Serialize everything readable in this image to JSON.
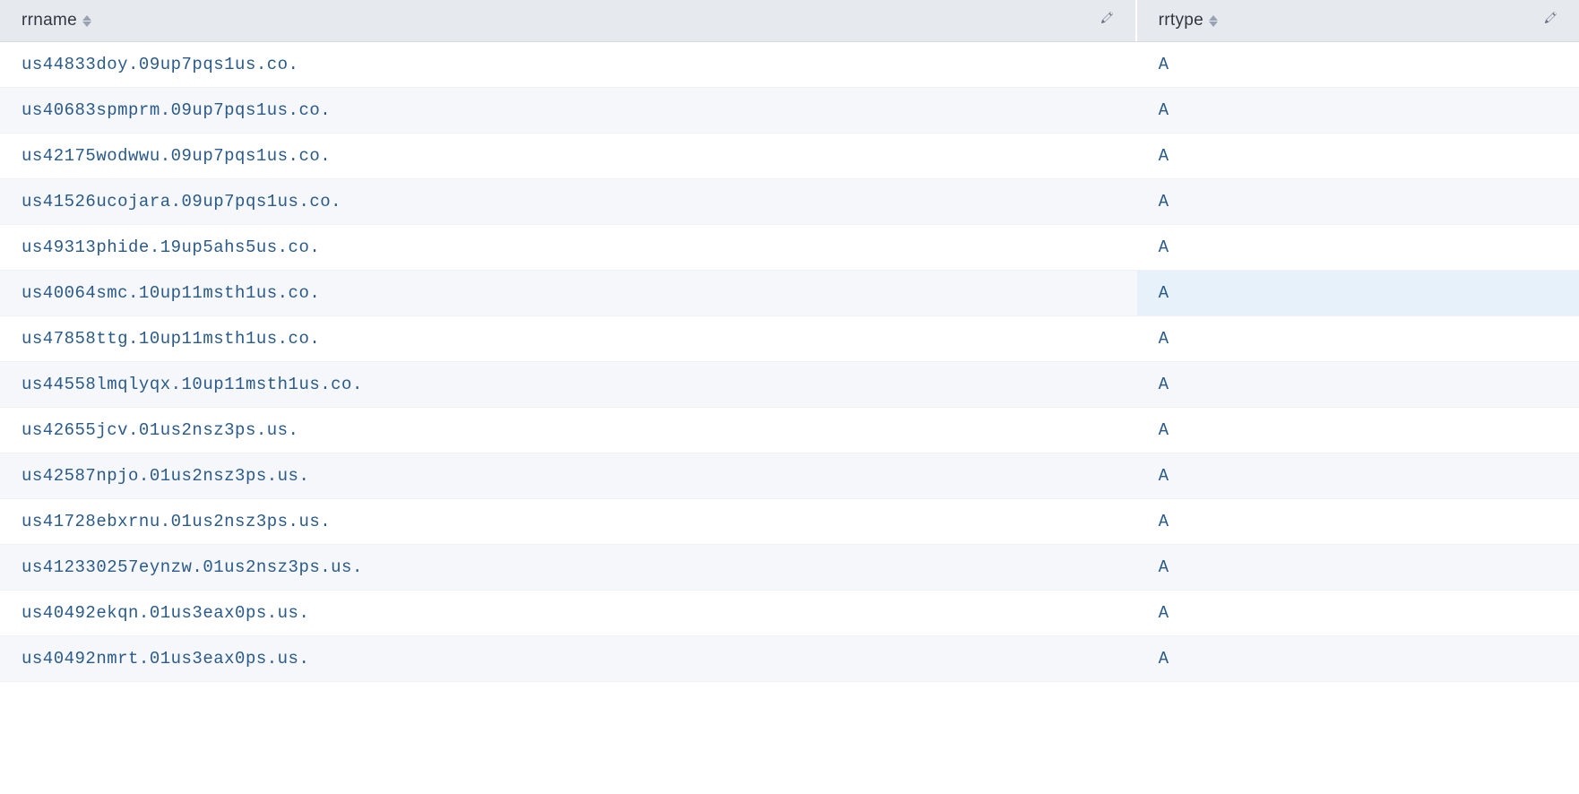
{
  "table": {
    "columns": {
      "rrname": {
        "label": "rrname"
      },
      "rrtype": {
        "label": "rrtype"
      }
    },
    "rows": [
      {
        "rrname": "us44833doy.09up7pqs1us.co.",
        "rrtype": "A",
        "highlighted": false
      },
      {
        "rrname": "us40683spmprm.09up7pqs1us.co.",
        "rrtype": "A",
        "highlighted": false
      },
      {
        "rrname": "us42175wodwwu.09up7pqs1us.co.",
        "rrtype": "A",
        "highlighted": false
      },
      {
        "rrname": "us41526ucojara.09up7pqs1us.co.",
        "rrtype": "A",
        "highlighted": false
      },
      {
        "rrname": "us49313phide.19up5ahs5us.co.",
        "rrtype": "A",
        "highlighted": false
      },
      {
        "rrname": "us40064smc.10up11msth1us.co.",
        "rrtype": "A",
        "highlighted": true
      },
      {
        "rrname": "us47858ttg.10up11msth1us.co.",
        "rrtype": "A",
        "highlighted": false
      },
      {
        "rrname": "us44558lmqlyqx.10up11msth1us.co.",
        "rrtype": "A",
        "highlighted": false
      },
      {
        "rrname": "us42655jcv.01us2nsz3ps.us.",
        "rrtype": "A",
        "highlighted": false
      },
      {
        "rrname": "us42587npjo.01us2nsz3ps.us.",
        "rrtype": "A",
        "highlighted": false
      },
      {
        "rrname": "us41728ebxrnu.01us2nsz3ps.us.",
        "rrtype": "A",
        "highlighted": false
      },
      {
        "rrname": "us412330257eynzw.01us2nsz3ps.us.",
        "rrtype": "A",
        "highlighted": false
      },
      {
        "rrname": "us40492ekqn.01us3eax0ps.us.",
        "rrtype": "A",
        "highlighted": false
      },
      {
        "rrname": "us40492nmrt.01us3eax0ps.us.",
        "rrtype": "A",
        "highlighted": false
      }
    ]
  }
}
